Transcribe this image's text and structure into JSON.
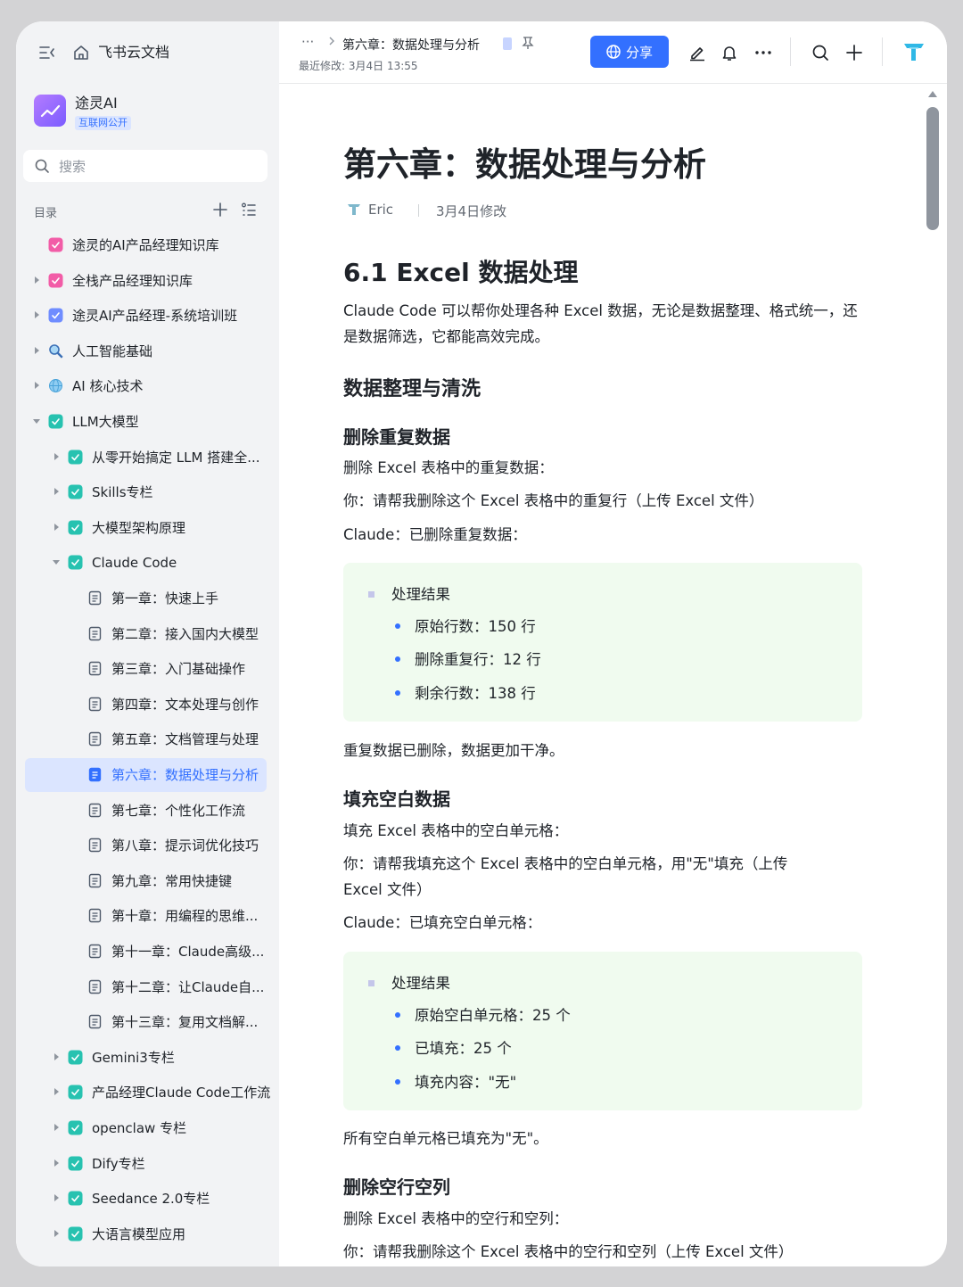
{
  "sidebar": {
    "home_label": "飞书云文档",
    "workspace": {
      "name": "途灵AI",
      "badge": "互联网公开"
    },
    "search_placeholder": "搜索",
    "toc_label": "目录",
    "items": [
      {
        "label": "途灵的AI产品经理知识库",
        "icon": "wiki-pink-icon",
        "depth": 0,
        "caret": "none"
      },
      {
        "label": "全栈产品经理知识库",
        "icon": "wiki-pink-icon",
        "depth": 0,
        "caret": "right"
      },
      {
        "label": "途灵AI产品经理-系统培训班",
        "icon": "wiki-blue-icon",
        "depth": 0,
        "caret": "right"
      },
      {
        "label": "人工智能基础",
        "icon": "magnifier-emoji-icon",
        "depth": 0,
        "caret": "right"
      },
      {
        "label": "AI 核心技术",
        "icon": "globe-emoji-icon",
        "depth": 0,
        "caret": "right"
      },
      {
        "label": "LLM大模型",
        "icon": "wiki-teal-icon",
        "depth": 0,
        "caret": "down"
      },
      {
        "label": "从零开始搞定 LLM 搭建全...",
        "icon": "wiki-teal-icon",
        "depth": 1,
        "caret": "right"
      },
      {
        "label": "Skills专栏",
        "icon": "wiki-teal-icon",
        "depth": 1,
        "caret": "right"
      },
      {
        "label": "大模型架构原理",
        "icon": "wiki-teal-icon",
        "depth": 1,
        "caret": "right"
      },
      {
        "label": "Claude Code",
        "icon": "wiki-teal-icon",
        "depth": 1,
        "caret": "down"
      },
      {
        "label": "第一章：快速上手",
        "icon": "doc-icon",
        "depth": 2,
        "caret": "none"
      },
      {
        "label": "第二章：接入国内大模型",
        "icon": "doc-icon",
        "depth": 2,
        "caret": "none"
      },
      {
        "label": "第三章：入门基础操作",
        "icon": "doc-icon",
        "depth": 2,
        "caret": "none"
      },
      {
        "label": "第四章：文本处理与创作",
        "icon": "doc-icon",
        "depth": 2,
        "caret": "none"
      },
      {
        "label": "第五章：文档管理与处理",
        "icon": "doc-icon",
        "depth": 2,
        "caret": "none"
      },
      {
        "label": "第六章：数据处理与分析",
        "icon": "doc-icon",
        "depth": 2,
        "caret": "none",
        "active": true
      },
      {
        "label": "第七章：个性化工作流",
        "icon": "doc-icon",
        "depth": 2,
        "caret": "none"
      },
      {
        "label": "第八章：提示词优化技巧",
        "icon": "doc-icon",
        "depth": 2,
        "caret": "none"
      },
      {
        "label": "第九章：常用快捷键",
        "icon": "doc-icon",
        "depth": 2,
        "caret": "none"
      },
      {
        "label": "第十章：用编程的思维...",
        "icon": "doc-icon",
        "depth": 2,
        "caret": "none"
      },
      {
        "label": "第十一章：Claude高级...",
        "icon": "doc-icon",
        "depth": 2,
        "caret": "none"
      },
      {
        "label": "第十二章：让Claude自...",
        "icon": "doc-icon",
        "depth": 2,
        "caret": "none"
      },
      {
        "label": "第十三章：复用文档解...",
        "icon": "doc-icon",
        "depth": 2,
        "caret": "none"
      },
      {
        "label": "Gemini3专栏",
        "icon": "wiki-teal-icon",
        "depth": 1,
        "caret": "right"
      },
      {
        "label": "产品经理Claude Code工作流",
        "icon": "wiki-teal-icon",
        "depth": 1,
        "caret": "right"
      },
      {
        "label": "openclaw 专栏",
        "icon": "wiki-teal-icon",
        "depth": 1,
        "caret": "right"
      },
      {
        "label": "Dify专栏",
        "icon": "wiki-teal-icon",
        "depth": 1,
        "caret": "right"
      },
      {
        "label": "Seedance 2.0专栏",
        "icon": "wiki-teal-icon",
        "depth": 1,
        "caret": "right"
      },
      {
        "label": "大语言模型应用",
        "icon": "wiki-teal-icon",
        "depth": 1,
        "caret": "right"
      }
    ]
  },
  "topbar": {
    "breadcrumb_more": "···",
    "breadcrumb": "第六章：数据处理与分析",
    "last_modified": "最近修改: 3月4日 13:55",
    "share_label": "分享"
  },
  "doc": {
    "title": "第六章：数据处理与分析",
    "author": "Eric",
    "modified": "3月4日修改",
    "section_title": "6.1 Excel 数据处理",
    "intro": "Claude Code 可以帮你处理各种 Excel 数据，无论是数据整理、格式统一，还是数据筛选，它都能高效完成。",
    "sub_title": "数据整理与清洗",
    "dedupe": {
      "heading": "删除重复数据",
      "desc": "删除 Excel 表格中的重复数据：",
      "user": "你：请帮我删除这个 Excel 表格中的重复行（上传 Excel 文件）",
      "claude": "Claude：已删除重复数据：",
      "callout_title": "处理结果",
      "bullets": [
        "原始行数：150 行",
        "删除重复行：12 行",
        "剩余行数：138 行"
      ],
      "conclusion": "重复数据已删除，数据更加干净。"
    },
    "fill": {
      "heading": "填充空白数据",
      "desc": "填充 Excel 表格中的空白单元格：",
      "user": "你：请帮我填充这个 Excel 表格中的空白单元格，用\"无\"填充（上传 Excel 文件）",
      "claude": "Claude：已填充空白单元格：",
      "callout_title": "处理结果",
      "bullets": [
        "原始空白单元格：25 个",
        "已填充：25 个",
        "填充内容：\"无\""
      ],
      "conclusion": "所有空白单元格已填充为\"无\"。"
    },
    "blank": {
      "heading": "删除空行空列",
      "desc": "删除 Excel 表格中的空行和空列：",
      "user": "你：请帮我删除这个 Excel 表格中的空行和空列（上传 Excel 文件）"
    }
  },
  "colors": {
    "accent": "#3370ff",
    "active_bg": "#dbe5ff",
    "callout_bg": "#f0fbef",
    "sidebar_bg": "#f2f3f5"
  }
}
